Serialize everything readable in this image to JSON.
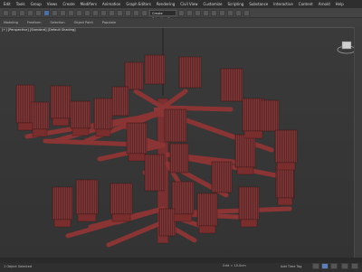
{
  "menu": [
    "Edit",
    "Tools",
    "Group",
    "Views",
    "Create",
    "Modifiers",
    "Animation",
    "Graph Editors",
    "Rendering",
    "Civil View",
    "Customize",
    "Scripting",
    "Substance",
    "Interactive",
    "Content",
    "Arnold",
    "Help"
  ],
  "toolbar": {
    "selection_set": "Create Selection Se"
  },
  "ribbon": [
    "Modeling",
    "Freeform",
    "Selection",
    "Object Paint",
    "Populate"
  ],
  "viewport": {
    "label": "[+] [Perspective] [Standard] [Default Shading]"
  },
  "status": {
    "text": "1 Object Selected",
    "coords": "Grid = 10.0cm",
    "addtime": "Add Time Tag"
  },
  "colors": {
    "object": "#8a3b3b",
    "object_dark": "#5e2525",
    "object_light": "#b55a5a"
  }
}
